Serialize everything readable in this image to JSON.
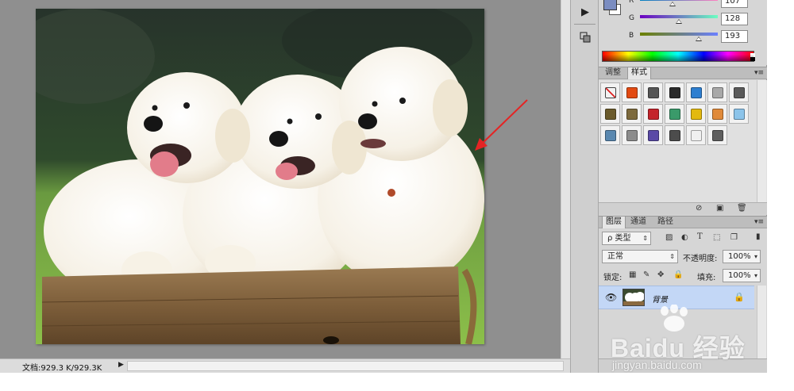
{
  "status_bar": {
    "doc_info": "文档:929.3 K/929.3K",
    "menu_arrow": "▶"
  },
  "gutter": {
    "play_icon": "play-icon",
    "layer_comp_icon": "layer-comp-icon"
  },
  "color_panel": {
    "foreground_color": "#7b8dc1",
    "channels": [
      {
        "label": "R",
        "value": "107",
        "position": 0.42
      },
      {
        "label": "G",
        "value": "128",
        "position": 0.5
      },
      {
        "label": "B",
        "value": "193",
        "position": 0.76
      }
    ]
  },
  "styles_panel": {
    "tabs": [
      "调整",
      "样式"
    ],
    "active_tab": 1,
    "menu": "▾≡",
    "swatches": [
      {
        "icon": "none-style-icon",
        "color": "#ffffff"
      },
      {
        "icon": "glow-style-icon",
        "color": "#e24a12"
      },
      {
        "icon": "stroke-style-icon",
        "color": "#555555"
      },
      {
        "icon": "bevel-dark-style-icon",
        "color": "#2a2a2a"
      },
      {
        "icon": "blue-glass-style-icon",
        "color": "#2e7fd0"
      },
      {
        "icon": "gray-style-icon",
        "color": "#a8a8a8"
      },
      {
        "icon": "dark-gradient-style-icon",
        "color": "#5a5a5a"
      },
      {
        "icon": "olive-style-icon",
        "color": "#6b5b2c"
      },
      {
        "icon": "bronze-style-icon",
        "color": "#7d6a3d"
      },
      {
        "icon": "red-style-icon",
        "color": "#c4242b"
      },
      {
        "icon": "multicolor-style-icon",
        "color": "#3a9a6a"
      },
      {
        "icon": "yellow-style-icon",
        "color": "#e3b90f"
      },
      {
        "icon": "orange-gradient-style-icon",
        "color": "#e08a3a"
      },
      {
        "icon": "light-blue-style-icon",
        "color": "#8cc4ea"
      },
      {
        "icon": "landscape-style-icon",
        "color": "#5a88b0"
      },
      {
        "icon": "texture-style-icon",
        "color": "#8c8c8c"
      },
      {
        "icon": "purple-style-icon",
        "color": "#5a4aa6"
      },
      {
        "icon": "charcoal-style-icon",
        "color": "#4c4c4c"
      },
      {
        "icon": "outline-style-icon",
        "color": "#f0f0f0"
      },
      {
        "icon": "slate-style-icon",
        "color": "#5e5e5e"
      }
    ],
    "footer_icons": [
      "clear-style-icon",
      "new-style-icon",
      "trash-icon"
    ]
  },
  "layers_panel": {
    "tabs": [
      "图层",
      "通道",
      "路径"
    ],
    "active_tab": 0,
    "menu": "▾≡",
    "filter_kind": "ρ 类型",
    "blend_mode": "正常",
    "opacity_label": "不透明度:",
    "opacity_value": "100%",
    "lock_label": "锁定:",
    "fill_label": "填充:",
    "fill_value": "100%",
    "layer_name": "背景"
  },
  "watermark": {
    "brand": "Baidu 经验",
    "url": "jingyan.baidu.com"
  }
}
